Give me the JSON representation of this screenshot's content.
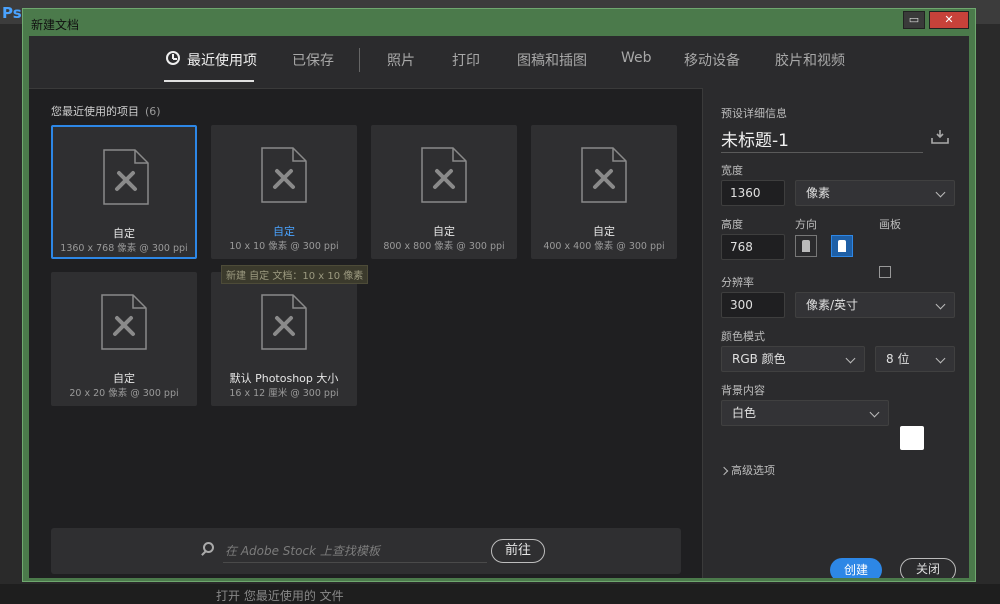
{
  "app": {
    "logo": "Ps",
    "bottom_text": "打开 您最近使用的 文件"
  },
  "dialog": {
    "title": "新建文档",
    "minimize": "▭",
    "close": "✕"
  },
  "tabs": [
    {
      "label": "最近使用项",
      "active": true
    },
    {
      "label": "已保存"
    },
    {
      "label": "照片"
    },
    {
      "label": "打印"
    },
    {
      "label": "图稿和插图"
    },
    {
      "label": "Web"
    },
    {
      "label": "移动设备"
    },
    {
      "label": "胶片和视频"
    }
  ],
  "recent": {
    "heading": "您最近使用的项目",
    "count": "(6)"
  },
  "tiles": [
    {
      "name": "自定",
      "sub": "1360 x 768 像素 @ 300 ppi",
      "selected": true
    },
    {
      "name": "自定",
      "sub": "10 x 10 像素 @ 300 ppi"
    },
    {
      "name": "自定",
      "sub": "800 x 800 像素 @ 300 ppi"
    },
    {
      "name": "自定",
      "sub": "400 x 400 像素 @ 300 ppi"
    },
    {
      "name": "自定",
      "sub": "20 x 20 像素 @ 300 ppi"
    },
    {
      "name": "默认 Photoshop 大小",
      "sub": "16 x 12 厘米 @ 300 ppi"
    }
  ],
  "tooltip": "新建 自定 文档：10 x 10 像素",
  "search": {
    "placeholder": "在 Adobe Stock 上查找模板",
    "go_label": "前往"
  },
  "preset": {
    "heading": "预设详细信息",
    "doc_title": "未标题-1",
    "width_label": "宽度",
    "width_value": "1360",
    "width_unit": "像素",
    "height_label": "高度",
    "height_value": "768",
    "orientation_label": "方向",
    "artboard_label": "画板",
    "resolution_label": "分辨率",
    "resolution_value": "300",
    "resolution_unit": "像素/英寸",
    "color_mode_label": "颜色模式",
    "color_mode_value": "RGB 颜色",
    "bit_depth_value": "8 位",
    "background_label": "背景内容",
    "background_value": "白色",
    "advanced_label": "高级选项",
    "create_label": "创建",
    "close_label": "关闭"
  },
  "colors": {
    "accent": "#2d87e6",
    "frame": "#4b7a4b",
    "panel": "#2b2b2d",
    "main": "#1f1f21"
  }
}
